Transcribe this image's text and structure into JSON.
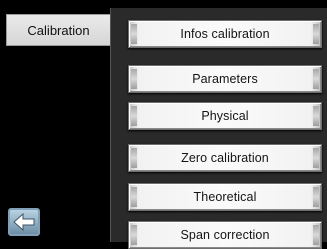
{
  "sidebar": {
    "active_tab_label": "Calibration",
    "back_icon": "left-arrow-icon"
  },
  "menu": {
    "items": [
      {
        "label": "Infos calibration"
      },
      {
        "label": "Parameters"
      },
      {
        "label": "Physical"
      },
      {
        "label": "Zero calibration"
      },
      {
        "label": "Theoretical"
      },
      {
        "label": "Span correction"
      }
    ]
  },
  "colors": {
    "background": "#000000",
    "panel": "#2a2a2a",
    "button_face": "#f2f2f2",
    "back_button": "#8fb0c6"
  }
}
